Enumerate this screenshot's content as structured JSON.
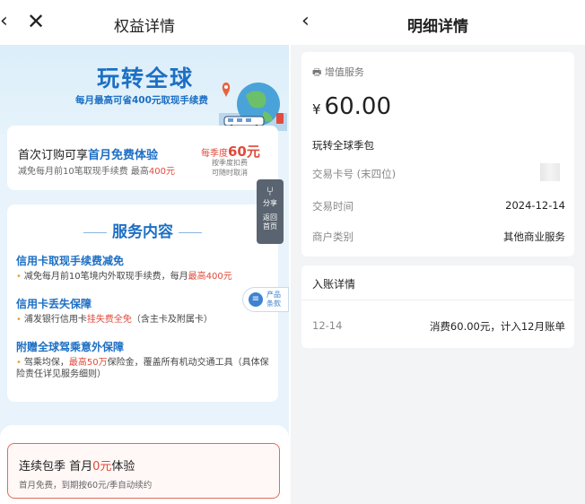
{
  "left": {
    "header": {
      "title": "权益详情"
    },
    "banner": {
      "title": "玩转全球",
      "subtitle": "每月最高可省400元取现手续费"
    },
    "promo": {
      "headline_prefix": "首次订购可享",
      "headline_highlight": "首月免费体验",
      "desc_prefix": "减免每月前10笔取现手续费 最高",
      "desc_highlight": "400元",
      "price_prefix": "每季度",
      "price_value": "60元",
      "note_line1": "按季度扣费",
      "note_line2": "可随时取消"
    },
    "share": {
      "share_label": "分享",
      "home_label_1": "返回",
      "home_label_2": "首页"
    },
    "product_terms": {
      "line1": "产品",
      "line2": "条款"
    },
    "services": {
      "title": "服务内容",
      "items": [
        {
          "heading": "信用卡取现手续费减免",
          "desc_prefix": "减免每月前10笔境内外取现手续费，每月",
          "desc_highlight": "最高400元",
          "desc_suffix": ""
        },
        {
          "heading": "信用卡丢失保障",
          "desc_prefix": "浦发银行信用卡",
          "desc_highlight": "挂失费全免",
          "desc_suffix": "（含主卡及附属卡）"
        },
        {
          "heading": "附赠全球驾乘意外保障",
          "desc_prefix": "驾乘均保，",
          "desc_highlight": "最高50万",
          "desc_suffix": "保险金，覆盖所有机动交通工具（具体保险责任详见服务细则）"
        }
      ]
    },
    "bottom": {
      "title_prefix": "连续包季 首月",
      "title_highlight": "0元",
      "title_suffix": "体验",
      "subtitle": "首月免费，到期按60元/季自动续约"
    }
  },
  "right": {
    "header": {
      "title": "明细详情"
    },
    "summary": {
      "tag": "增值服务",
      "currency": "¥",
      "amount": "60.00",
      "name": "玩转全球季包",
      "rows": [
        {
          "label": "交易卡号 (末四位)",
          "value": ""
        },
        {
          "label": "交易时间",
          "value": "2024-12-14"
        },
        {
          "label": "商户类别",
          "value": "其他商业服务"
        }
      ]
    },
    "entry": {
      "title": "入账详情",
      "date": "12-14",
      "desc": "消费60.00元，计入12月账单"
    }
  },
  "colors": {
    "accent_blue": "#1d6fc4",
    "accent_red": "#e04a3a"
  }
}
